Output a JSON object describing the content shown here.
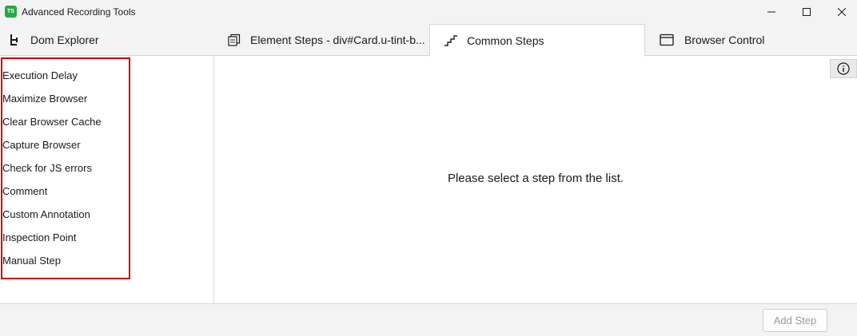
{
  "window": {
    "title": "Advanced Recording Tools",
    "app_icon_text": "TS",
    "app_icon_color": "#27a844"
  },
  "tabs": [
    {
      "label": "Dom Explorer",
      "icon": "dom-tree-icon",
      "active": false
    },
    {
      "label": "Element Steps - div#Card.u-tint-b...",
      "icon": "stacked-pages-icon",
      "active": false
    },
    {
      "label": "Common Steps",
      "icon": "stairs-icon",
      "active": true
    },
    {
      "label": "Browser Control",
      "icon": "browser-window-icon",
      "active": false
    }
  ],
  "steps": [
    "Execution Delay",
    "Maximize Browser",
    "Clear Browser Cache",
    "Capture Browser",
    "Check for JS errors",
    "Comment",
    "Custom Annotation",
    "Inspection Point",
    "Manual Step"
  ],
  "highlight_color": "#c00000",
  "main": {
    "placeholder": "Please select a step from the list."
  },
  "footer": {
    "add_step_label": "Add Step",
    "add_step_enabled": false
  }
}
